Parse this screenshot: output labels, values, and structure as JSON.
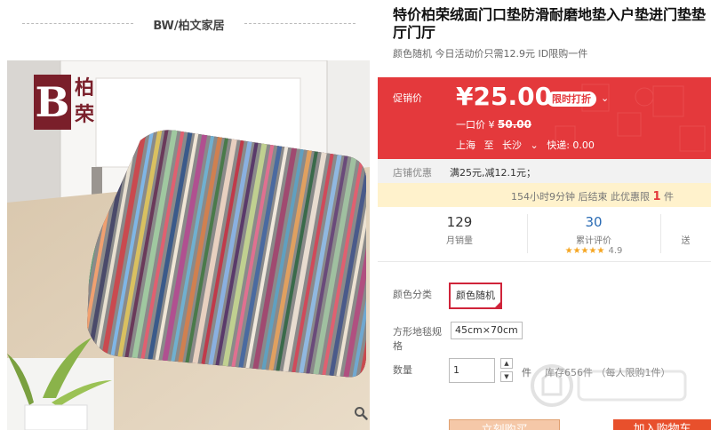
{
  "store": {
    "name": "BW/柏文家居"
  },
  "brand_logo": {
    "letter": "B",
    "chinese": "柏荣"
  },
  "product": {
    "title_line1": "特价柏荣绒面门口垫防滑耐磨地垫入户垫进门垫垫",
    "title_line2": "厅门厅",
    "subtitle": "颜色随机 今日活动价只需12.9元 ID限购一件"
  },
  "price": {
    "label": "促销价",
    "current": "¥25.00",
    "badge": "限时打折",
    "original_label": "一口价 ¥",
    "original_value": "50.00",
    "ship_from": "上海",
    "ship_to_word": "至",
    "ship_dest": "长沙",
    "ship_fee": "快递: 0.00"
  },
  "shop_promo": {
    "label": "店铺优惠",
    "value": "满25元,减12.1元；"
  },
  "countdown": {
    "prefix": "154小时9分钟 后结束  此优惠限 ",
    "limit": "1",
    "suffix": " 件"
  },
  "stats": [
    {
      "number": "129",
      "label": "月销量"
    },
    {
      "number": "30",
      "label": "累计评价",
      "stars": "★★★★★",
      "rating": "4.9"
    },
    {
      "label": "送"
    }
  ],
  "options": {
    "color_label": "颜色分类",
    "color_value": "颜色随机",
    "size_label_1": "方形地毯规",
    "size_label_2": "格",
    "size_value": "45cm×70cm",
    "qty_label": "数量",
    "qty_value": "1",
    "qty_unit": "件",
    "stock": "库存656件 （每人限购1件）"
  },
  "buttons": {
    "buy": "立刻购买",
    "cart": "加入购物车"
  },
  "colors": {
    "accent_red": "#e4393c",
    "link_blue": "#2a6bb4",
    "mat_border": "#5a1a22"
  },
  "icons": {
    "zoom": "magnifier-icon",
    "chevron": "chevron-down-icon",
    "up": "caret-up-icon",
    "down": "caret-down-icon"
  }
}
